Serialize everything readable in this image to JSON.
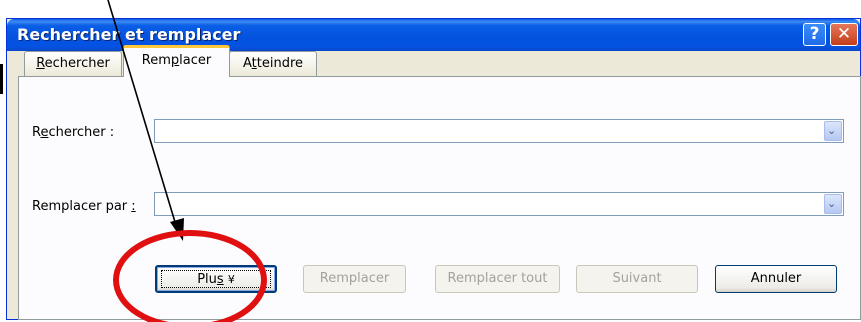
{
  "window": {
    "title": "Rechercher et remplacer",
    "help_glyph": "?",
    "close_glyph": "✕"
  },
  "tabs": [
    {
      "before": "",
      "key": "R",
      "after": "echercher",
      "active": false
    },
    {
      "before": "Rem",
      "key": "p",
      "after": "lacer",
      "active": true
    },
    {
      "before": "A",
      "key": "t",
      "after": "teindre",
      "active": false
    }
  ],
  "find": {
    "label_before": "R",
    "label_key": "e",
    "label_after": "chercher :",
    "value": ""
  },
  "replace": {
    "label_before": "Remplacer par ",
    "label_key": ":",
    "label_after": "",
    "value": ""
  },
  "buttons": {
    "plus": {
      "label_before": "Plu",
      "label_key": "s",
      "glyph": "¥"
    },
    "remplacer": "Remplacer",
    "remplacer_tout": "Remplacer tout",
    "suivant": "Suivant",
    "annuler": "Annuler"
  },
  "dropdown_glyph": "⌄",
  "colors": {
    "titlebar": "#0451df",
    "dialog_bg": "#ece9d8",
    "tab_highlight": "#ffc83c",
    "annotation_circle": "#e01010",
    "annotation_arrow": "#000000"
  }
}
